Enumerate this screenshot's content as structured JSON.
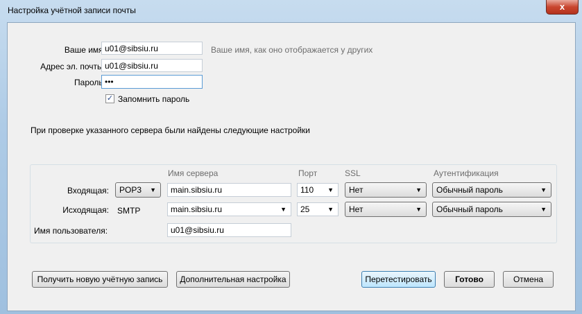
{
  "window": {
    "title": "Настройка учётной записи почты",
    "close": "x"
  },
  "form": {
    "name_label": "Ваше имя:",
    "name_value": "u01@sibsiu.ru",
    "name_hint": "Ваше имя, как оно отображается у других",
    "email_label": "Адрес эл. почты:",
    "email_value": "u01@sibsiu.ru",
    "password_label": "Пароль:",
    "password_value": "•••",
    "remember_label": "Запомнить пароль",
    "remember_checked": true,
    "check_mark": "✓"
  },
  "status": "При проверке указанного сервера были найдены следующие настройки",
  "servers": {
    "headers": {
      "server": "Имя сервера",
      "port": "Порт",
      "ssl": "SSL",
      "auth": "Аутентификация"
    },
    "incoming": {
      "label": "Входящая:",
      "protocol": "POP3",
      "server": "main.sibsiu.ru",
      "port": "110",
      "ssl": "Нет",
      "auth": "Обычный пароль"
    },
    "outgoing": {
      "label": "Исходящая:",
      "protocol": "SMTP",
      "server": "main.sibsiu.ru",
      "port": "25",
      "ssl": "Нет",
      "auth": "Обычный пароль"
    },
    "username": {
      "label": "Имя пользователя:",
      "value": "u01@sibsiu.ru"
    }
  },
  "buttons": {
    "new_account": "Получить новую учётную запись",
    "advanced": "Дополнительная настройка",
    "retest": "Перетестировать",
    "done": "Готово",
    "cancel": "Отмена"
  },
  "arrow": "▼"
}
